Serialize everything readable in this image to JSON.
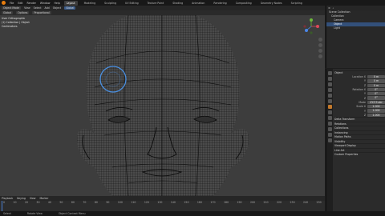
{
  "menu": [
    "File",
    "Edit",
    "Render",
    "Window",
    "Help"
  ],
  "workspaces": [
    "Layout",
    "Modeling",
    "Sculpting",
    "UV Editing",
    "Texture Paint",
    "Shading",
    "Animation",
    "Rendering",
    "Compositing",
    "Geometry Nodes",
    "Scripting"
  ],
  "active_workspace": "Layout",
  "header": [
    "Object Mode",
    "View",
    "Select",
    "Add",
    "Object",
    "Global"
  ],
  "header2": [
    "Global",
    "Options",
    "Proportional"
  ],
  "viewport_info": [
    "User Orthographic",
    "(1) Collection | Object",
    "Centimeters"
  ],
  "timeline_menu": [
    "Playback",
    "Keying",
    "View",
    "Marker"
  ],
  "frames": [
    "0",
    "10",
    "20",
    "30",
    "40",
    "50",
    "60",
    "70",
    "80",
    "90",
    "100",
    "110",
    "120",
    "130",
    "140",
    "150",
    "160",
    "170",
    "180",
    "190",
    "200",
    "210",
    "220",
    "230",
    "240",
    "250"
  ],
  "status": [
    "Select",
    "Rotate View",
    "Object Context Menu"
  ],
  "outliner": {
    "title": "Scene Collection",
    "rows": [
      "Collection",
      "Camera",
      "Object",
      "Light"
    ],
    "selected": 2
  },
  "properties": {
    "object_name": "Object",
    "rows": [
      {
        "label": "Location X",
        "value": "0 m"
      },
      {
        "label": "Y",
        "value": "0 m"
      },
      {
        "label": "Z",
        "value": "0 m"
      },
      {
        "label": "Rotation X",
        "value": "0°"
      },
      {
        "label": "Y",
        "value": "0°"
      },
      {
        "label": "Z",
        "value": "0°"
      },
      {
        "label": "Mode",
        "value": "XYZ Euler"
      },
      {
        "label": "Scale X",
        "value": "1.000"
      },
      {
        "label": "Y",
        "value": "1.000"
      },
      {
        "label": "Z",
        "value": "1.000"
      }
    ],
    "sections": [
      "Delta Transform",
      "Relations",
      "Collections",
      "Instancing",
      "Motion Paths",
      "Visibility",
      "Viewport Display",
      "Line Art",
      "Custom Properties"
    ]
  },
  "colors": {
    "accent": "#e87d0d",
    "selection": "#33507a",
    "brush": "#4a90e2",
    "mesh": "#0b0b0b"
  }
}
